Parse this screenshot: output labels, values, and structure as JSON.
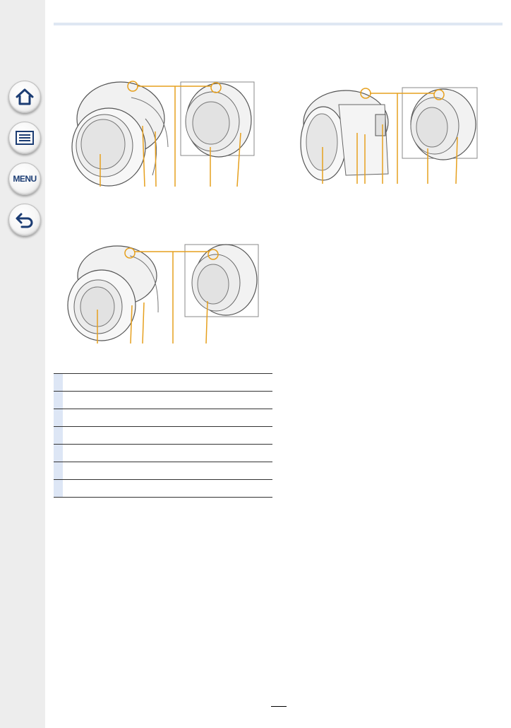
{
  "sidebar": {
    "items": [
      {
        "name": "home-icon",
        "label": ""
      },
      {
        "name": "list-icon",
        "label": ""
      },
      {
        "name": "menu-icon",
        "label": "MENU"
      },
      {
        "name": "back-icon",
        "label": ""
      }
    ]
  },
  "colors": {
    "sidebar_bg": "#ededed",
    "callout_line": "#e6a01e",
    "header_rule": "#dfe7f3",
    "table_number_cell": "#dde6f5"
  },
  "parts_table": {
    "rows": [
      {
        "number": "",
        "label": ""
      },
      {
        "number": "",
        "label": ""
      },
      {
        "number": "",
        "label": ""
      },
      {
        "number": "",
        "label": ""
      },
      {
        "number": "",
        "label": ""
      },
      {
        "number": "",
        "label": ""
      },
      {
        "number": "",
        "label": ""
      }
    ]
  },
  "page_number": ""
}
